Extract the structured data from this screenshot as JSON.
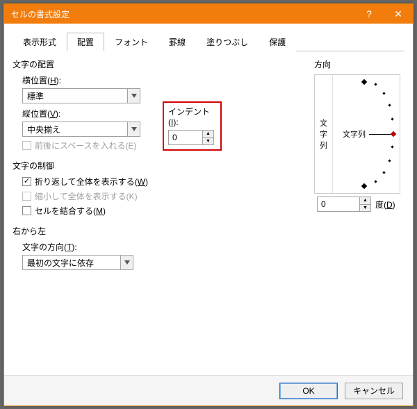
{
  "window": {
    "title": "セルの書式設定"
  },
  "tabs": [
    "表示形式",
    "配置",
    "フォント",
    "罫線",
    "塗りつぶし",
    "保護"
  ],
  "active_tab_index": 1,
  "alignment": {
    "group_label": "文字の配置",
    "horizontal_label": "横位置(",
    "horizontal_key": "H",
    "horizontal_value": "標準",
    "vertical_label": "縦位置(",
    "vertical_key": "V",
    "vertical_value": "中央揃え",
    "indent_label": "インデント(",
    "indent_key": "I",
    "indent_value": "0",
    "space_check": "前後にスペースを入れる(E)"
  },
  "control": {
    "group_label": "文字の制御",
    "wrap": "折り返して全体を表示する(",
    "wrap_key": "W",
    "shrink": "縮小して全体を表示する(K)",
    "merge": "セルを結合する(",
    "merge_key": "M"
  },
  "rtl": {
    "group_label": "右から左",
    "direction_label": "文字の方向(",
    "direction_key": "T",
    "direction_value": "最初の文字に依存"
  },
  "orientation": {
    "group_label": "方向",
    "vertical_text": "文字列",
    "dial_text": "文字列",
    "degree_value": "0",
    "degree_label": "度(",
    "degree_key": "D"
  },
  "buttons": {
    "ok": "OK",
    "cancel": "キャンセル"
  }
}
